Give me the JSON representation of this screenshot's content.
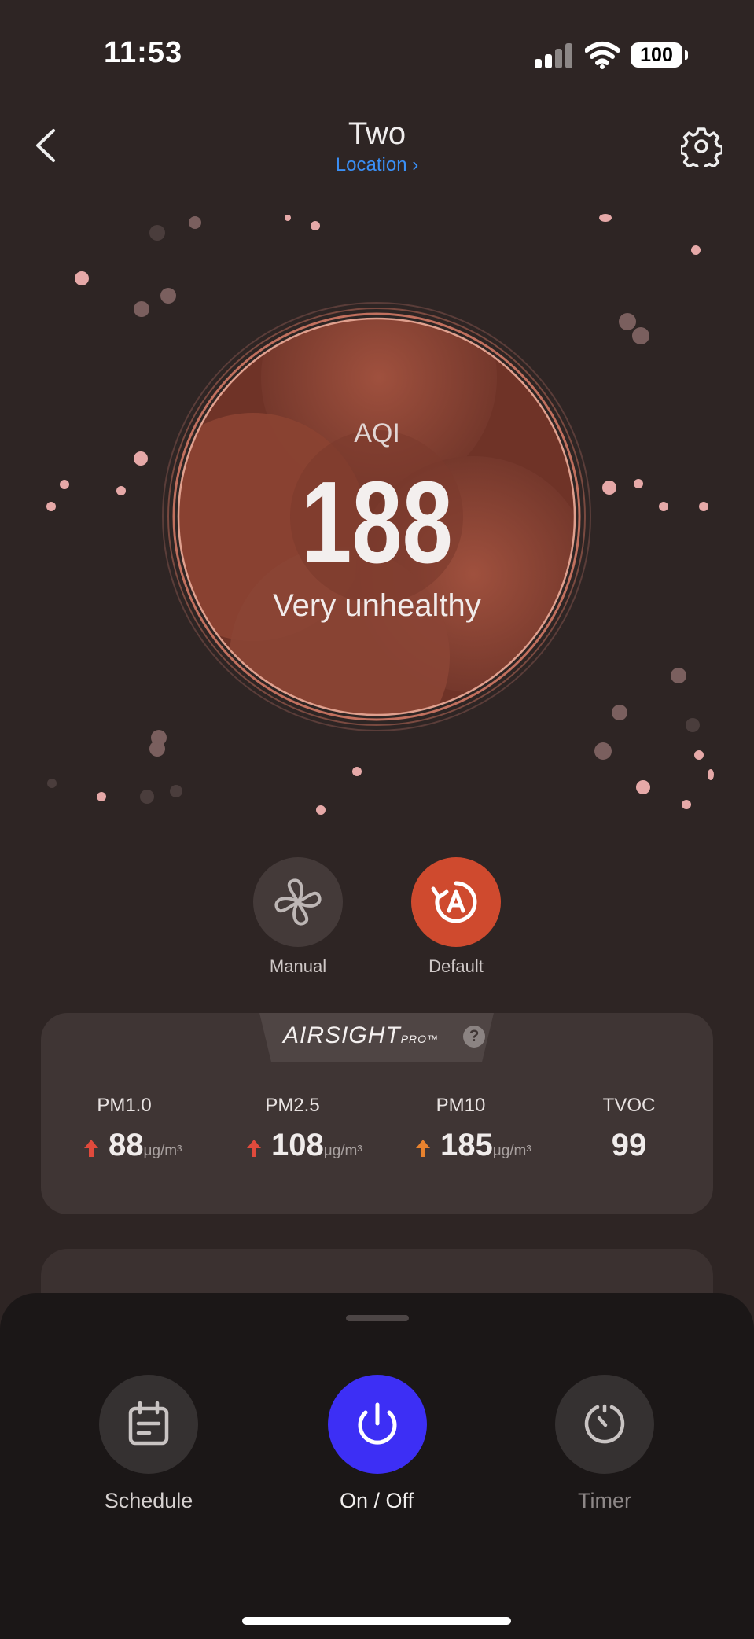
{
  "status_bar": {
    "time": "11:53",
    "battery": "100"
  },
  "header": {
    "title": "Two",
    "location_link": "Location ›"
  },
  "aqi": {
    "label": "AQI",
    "value": "188",
    "status": "Very unhealthy"
  },
  "modes": [
    {
      "label": "Manual",
      "icon": "fan-icon"
    },
    {
      "label": "Default",
      "icon": "auto-mode-icon"
    }
  ],
  "sensor_card": {
    "brand": "AIRSIGHT",
    "brand_suffix": "PRO™",
    "metrics": [
      {
        "name": "PM1.0",
        "value": "88",
        "unit": "μg/m³",
        "trend": "up",
        "trend_color": "#e04a3c"
      },
      {
        "name": "PM2.5",
        "value": "108",
        "unit": "μg/m³",
        "trend": "up",
        "trend_color": "#e04a3c"
      },
      {
        "name": "PM10",
        "value": "185",
        "unit": "μg/m³",
        "trend": "up",
        "trend_color": "#e8822e"
      },
      {
        "name": "TVOC",
        "value": "99",
        "unit": "",
        "trend": "none"
      }
    ]
  },
  "controls": [
    {
      "label": "Schedule",
      "icon": "calendar-icon"
    },
    {
      "label": "On / Off",
      "icon": "power-icon"
    },
    {
      "label": "Timer",
      "icon": "timer-icon"
    }
  ],
  "colors": {
    "background": "#2e2524",
    "accent_power": "#3d2ff5",
    "accent_default_mode": "#cf4a2e",
    "link": "#3a8ff5"
  }
}
